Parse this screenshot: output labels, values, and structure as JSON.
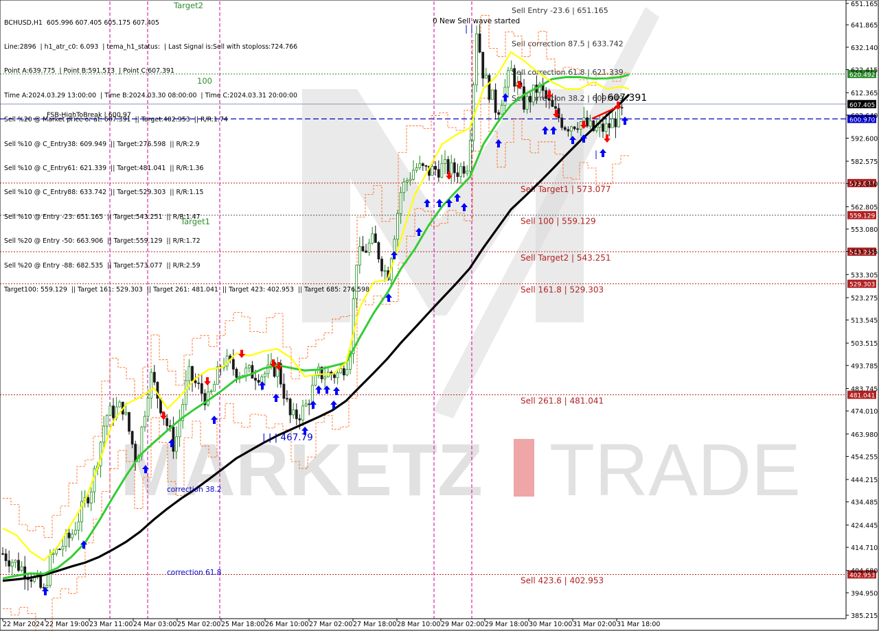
{
  "info": {
    "lines": [
      "BCHUSD,H1  605.996 607.405 605.175 607.405",
      "Line:2896  | h1_atr_c0: 6.093  | tema_h1_status:  | Last Signal is:Sell with stoploss:724.766",
      "Point A:639.775  | Point B:591.513  | Point C:607.391",
      "Time A:2024.03.29 13:00:00  | Time B:2024.03.30 08:00:00  | Time C:2024.03.31 20:00:00",
      "Sell %20 @ Market price or at: 607.391  || Target:402.953  || R/R:1.74",
      "Sell %10 @ C_Entry38: 609.949  || Target:276.598  || R/R:2.9",
      "Sell %10 @ C_Entry61: 621.339  || Target:481.041  || R/R:1.36",
      "Sell %10 @ C_Entry88: 633.742  || Target:529.303  || R/R:1.15",
      "Sell %10 @ Entry -23: 651.165  || Target:543.251  || R/R:1.47",
      "Sell %20 @ Entry -50: 663.906  || Target:559.129  || R/R:1.72",
      "Sell %20 @ Entry -88: 682.535  || Target:573.077  || R/R:2.59",
      "Target100: 559.129  || Target 161: 529.303  || Target 261: 481.041  || Target 423: 402.953  || Target 685: 276.598"
    ]
  },
  "colors": {
    "bull": "#1a8a1a",
    "bear": "#1a1a1a",
    "sma_slow": "#000000",
    "sma_mid": "#33cc33",
    "sma_fast": "#ffff00",
    "envelope": "#ff5500",
    "level_line": "#b22222",
    "level_green": "#2e8b2e",
    "price_blue": "#0000cc",
    "arrow_up": "#0000ff",
    "arrow_down": "#ff0000",
    "vline": "#cc0099",
    "watermark": "#d8d8d8",
    "watermark_red": "#e88080"
  },
  "watermark": {
    "brand_left": "MARKETZ",
    "brand_right": "TRADE"
  },
  "chart_data": {
    "type": "candlestick",
    "symbol": "BCHUSD,H1",
    "timeframe": "H1",
    "ylim": [
      382.5,
      655
    ],
    "y_ticks": [
      651.165,
      641.865,
      632.14,
      622.415,
      612.365,
      602.64,
      592.6,
      582.575,
      572.85,
      562.805,
      553.08,
      543.355,
      533.305,
      523.275,
      513.545,
      503.515,
      493.785,
      483.745,
      474.01,
      463.98,
      454.255,
      444.215,
      434.485,
      424.445,
      414.71,
      404.68,
      394.95,
      385.215
    ],
    "x_ticks": [
      "22 Mar 2024",
      "22 Mar 19:00",
      "23 Mar 11:00",
      "24 Mar 03:00",
      "25 Mar 02:00",
      "25 Mar 18:00",
      "26 Mar 10:00",
      "27 Mar 02:00",
      "27 Mar 18:00",
      "28 Mar 10:00",
      "29 Mar 02:00",
      "29 Mar 18:00",
      "30 Mar 10:00",
      "31 Mar 02:00",
      "31 Mar 18:00"
    ],
    "levels": [
      {
        "name": "Sell Entry -23.6 | 651.165",
        "value": 651.165,
        "style": "none",
        "box": "",
        "label_pos": "top"
      },
      {
        "name": "Sell correction 87.5 | 633.742",
        "value": 633.742,
        "style": "none",
        "box": "",
        "label_pos": "top"
      },
      {
        "name": "Sell correction 61.8 | 621.339",
        "value": 621.339,
        "style": "none",
        "box": "",
        "label_pos": "top"
      },
      {
        "name": "",
        "value": 620.492,
        "style": "dotted-green",
        "box": "620.492",
        "label_pos": ""
      },
      {
        "name": "Sell correction 38.2 | 609.949",
        "value": 609.949,
        "style": "none",
        "box": "",
        "label_pos": "top"
      },
      {
        "name": "",
        "value": 607.405,
        "style": "solid-gray",
        "box": "607.405",
        "label_pos": ""
      },
      {
        "name": "FSB-HighToBreak | 600.97",
        "value": 600.97,
        "style": "dashed-blue",
        "box": "600.970",
        "label_pos": "left"
      },
      {
        "name": "Sell Target1 | 573.077",
        "value": 573.077,
        "style": "dotted-red",
        "box": "573.077",
        "label_pos": "below"
      },
      {
        "name": "Sell 100 | 559.129",
        "value": 559.129,
        "style": "dotted-dark",
        "box": "559.129",
        "label_pos": "below"
      },
      {
        "name": "Sell Target2 | 543.251",
        "value": 543.251,
        "style": "dotted-red",
        "box": "543.251",
        "label_pos": "below"
      },
      {
        "name": "Sell 161.8 | 529.303",
        "value": 529.303,
        "style": "dotted-red",
        "box": "529.303",
        "label_pos": "below"
      },
      {
        "name": "Sell  261.8 | 481.041",
        "value": 481.041,
        "style": "dotted-red",
        "box": "481.041",
        "label_pos": "below"
      },
      {
        "name": "Sell  423.6 | 402.953",
        "value": 402.953,
        "style": "dotted-red",
        "box": "402.953",
        "label_pos": "below"
      }
    ],
    "annotations": {
      "target2": "Target2",
      "target1": "Target1",
      "hundred": "100",
      "new_wave": "0 New Sell wave started",
      "low_mark": "| | | 467.79",
      "price_c": "| | 607.391",
      "corr382": "correction 38.2",
      "corr618": "correction 61.8",
      "wave_marks": "| |",
      "wave_mark_single": "|"
    },
    "sma_slow": [
      [
        0,
        400.2
      ],
      [
        20,
        400.8
      ],
      [
        40,
        401.5
      ],
      [
        60,
        402.7
      ],
      [
        80,
        404.5
      ],
      [
        100,
        406.4
      ],
      [
        120,
        408.1
      ],
      [
        140,
        410.5
      ],
      [
        160,
        413.7
      ],
      [
        180,
        417.2
      ],
      [
        200,
        421.5
      ],
      [
        220,
        426.8
      ],
      [
        240,
        431.6
      ],
      [
        260,
        436.0
      ],
      [
        280,
        439.9
      ],
      [
        300,
        444.3
      ],
      [
        320,
        448.8
      ],
      [
        340,
        453.4
      ],
      [
        360,
        456.8
      ],
      [
        380,
        460.2
      ],
      [
        400,
        463.3
      ],
      [
        420,
        466.0
      ],
      [
        440,
        468.7
      ],
      [
        460,
        471.4
      ],
      [
        480,
        474.3
      ],
      [
        500,
        478.4
      ],
      [
        520,
        484.5
      ],
      [
        540,
        490.5
      ],
      [
        560,
        496.7
      ],
      [
        580,
        503.7
      ],
      [
        600,
        510.1
      ],
      [
        620,
        516.6
      ],
      [
        640,
        523.0
      ],
      [
        660,
        529.3
      ],
      [
        680,
        536.0
      ],
      [
        700,
        545.0
      ],
      [
        720,
        553.3
      ],
      [
        740,
        561.6
      ],
      [
        760,
        567.2
      ],
      [
        780,
        573.0
      ],
      [
        800,
        579.0
      ],
      [
        820,
        585.2
      ],
      [
        840,
        591.2
      ],
      [
        860,
        596.8
      ],
      [
        880,
        602.6
      ],
      [
        900,
        607.9
      ],
      [
        912,
        611.6
      ]
    ],
    "sma_mid": [
      [
        0,
        401.2
      ],
      [
        20,
        402.4
      ],
      [
        40,
        403.4
      ],
      [
        60,
        403.2
      ],
      [
        80,
        405.8
      ],
      [
        100,
        410.6
      ],
      [
        120,
        416.8
      ],
      [
        140,
        426.1
      ],
      [
        160,
        436.3
      ],
      [
        180,
        446.0
      ],
      [
        200,
        454.8
      ],
      [
        220,
        460.3
      ],
      [
        240,
        465.6
      ],
      [
        260,
        470.7
      ],
      [
        280,
        474.9
      ],
      [
        300,
        478.8
      ],
      [
        320,
        483.1
      ],
      [
        340,
        487.8
      ],
      [
        360,
        489.8
      ],
      [
        380,
        492.5
      ],
      [
        400,
        493.9
      ],
      [
        420,
        492.7
      ],
      [
        440,
        491.6
      ],
      [
        460,
        492.0
      ],
      [
        480,
        493.5
      ],
      [
        500,
        495.0
      ],
      [
        520,
        506.0
      ],
      [
        540,
        516.5
      ],
      [
        560,
        525.3
      ],
      [
        580,
        535.9
      ],
      [
        600,
        544.4
      ],
      [
        620,
        554.6
      ],
      [
        640,
        563.0
      ],
      [
        660,
        569.4
      ],
      [
        680,
        575.6
      ],
      [
        700,
        590.0
      ],
      [
        720,
        599.2
      ],
      [
        740,
        607.0
      ],
      [
        760,
        611.7
      ],
      [
        780,
        614.8
      ],
      [
        800,
        618.3
      ],
      [
        820,
        619.1
      ],
      [
        840,
        619.1
      ],
      [
        860,
        618.5
      ],
      [
        880,
        618.6
      ],
      [
        900,
        619.2
      ],
      [
        912,
        620.2
      ]
    ],
    "sma_fast": [
      [
        0,
        423.0
      ],
      [
        20,
        420.0
      ],
      [
        40,
        413.0
      ],
      [
        60,
        409.0
      ],
      [
        80,
        415.0
      ],
      [
        100,
        425.0
      ],
      [
        120,
        435.0
      ],
      [
        140,
        451.0
      ],
      [
        160,
        469.0
      ],
      [
        180,
        477.0
      ],
      [
        200,
        480.0
      ],
      [
        220,
        484.0
      ],
      [
        240,
        475.0
      ],
      [
        260,
        481.0
      ],
      [
        280,
        488.0
      ],
      [
        300,
        492.0
      ],
      [
        320,
        493.0
      ],
      [
        340,
        499.0
      ],
      [
        360,
        498.0
      ],
      [
        380,
        500.0
      ],
      [
        400,
        501.0
      ],
      [
        420,
        497.0
      ],
      [
        440,
        489.0
      ],
      [
        460,
        490.0
      ],
      [
        480,
        490.0
      ],
      [
        500,
        495.0
      ],
      [
        520,
        519.0
      ],
      [
        540,
        530.0
      ],
      [
        560,
        531.0
      ],
      [
        580,
        549.0
      ],
      [
        600,
        568.0
      ],
      [
        620,
        579.0
      ],
      [
        640,
        590.0
      ],
      [
        660,
        594.0
      ],
      [
        680,
        597.0
      ],
      [
        700,
        614.0
      ],
      [
        720,
        620.0
      ],
      [
        740,
        630.0
      ],
      [
        760,
        626.0
      ],
      [
        780,
        621.0
      ],
      [
        800,
        617.0
      ],
      [
        820,
        614.0
      ],
      [
        840,
        614.0
      ],
      [
        860,
        617.0
      ],
      [
        880,
        614.0
      ],
      [
        900,
        615.0
      ],
      [
        912,
        614.0
      ]
    ],
    "ohlc_note": "candles drawn at hourly resolution between 22 Mar 2024 and 31 Mar 18:00"
  }
}
